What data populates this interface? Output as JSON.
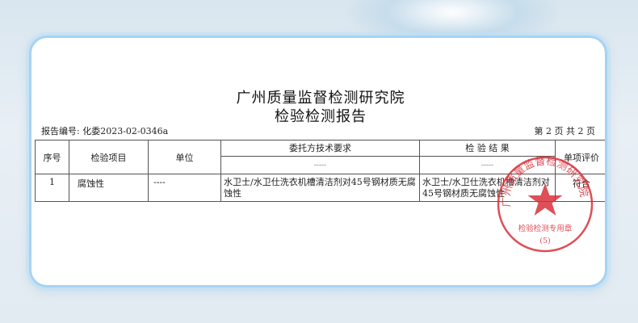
{
  "report": {
    "institution": "广州质量监督检测研究院",
    "doc_title": "检验检测报告",
    "report_no": "报告编号: 化委2023-02-0346a",
    "page_info": "第 2 页 共  2  页"
  },
  "table": {
    "headers": {
      "no": "序号",
      "item": "检验项目",
      "unit": "单位",
      "requirement": "委托方技术要求",
      "result": "检 验 结 果",
      "evaluation": "单项评价"
    },
    "sub_dash": "-----",
    "rows": [
      {
        "no": "1",
        "item": "腐蚀性",
        "unit": "----",
        "requirement": "水卫士/水卫仕洗衣机槽清洁剂对45号钢材质无腐蚀性",
        "result": "水卫士/水卫仕洗衣机槽清洁剂对45号钢材质无腐蚀性",
        "evaluation": "符合"
      }
    ]
  },
  "stamp": {
    "org_text": "广州质量监督检测研究院",
    "purpose": "检验检测专用章",
    "number": "(5)",
    "color": "#d8303a"
  },
  "theme": {
    "card_border": "#a6d3f2",
    "background": "#dfe9f1"
  }
}
